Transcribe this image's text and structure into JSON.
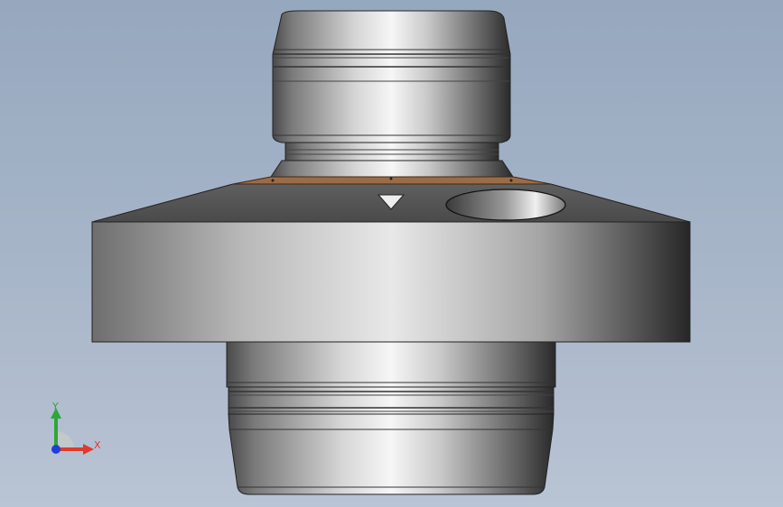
{
  "viewport": {
    "background_top": "#96a8be",
    "background_bottom": "#b9c4d4"
  },
  "part": {
    "metal_light": "#f4f4f4",
    "metal_dark": "#2b2b2b",
    "accent_face_color": "#9c6b45"
  },
  "triad": {
    "x_label": "X",
    "y_label": "Y",
    "x_color": "#e03a2a",
    "y_color": "#2fa63a",
    "z_color": "#1f3fd8"
  }
}
